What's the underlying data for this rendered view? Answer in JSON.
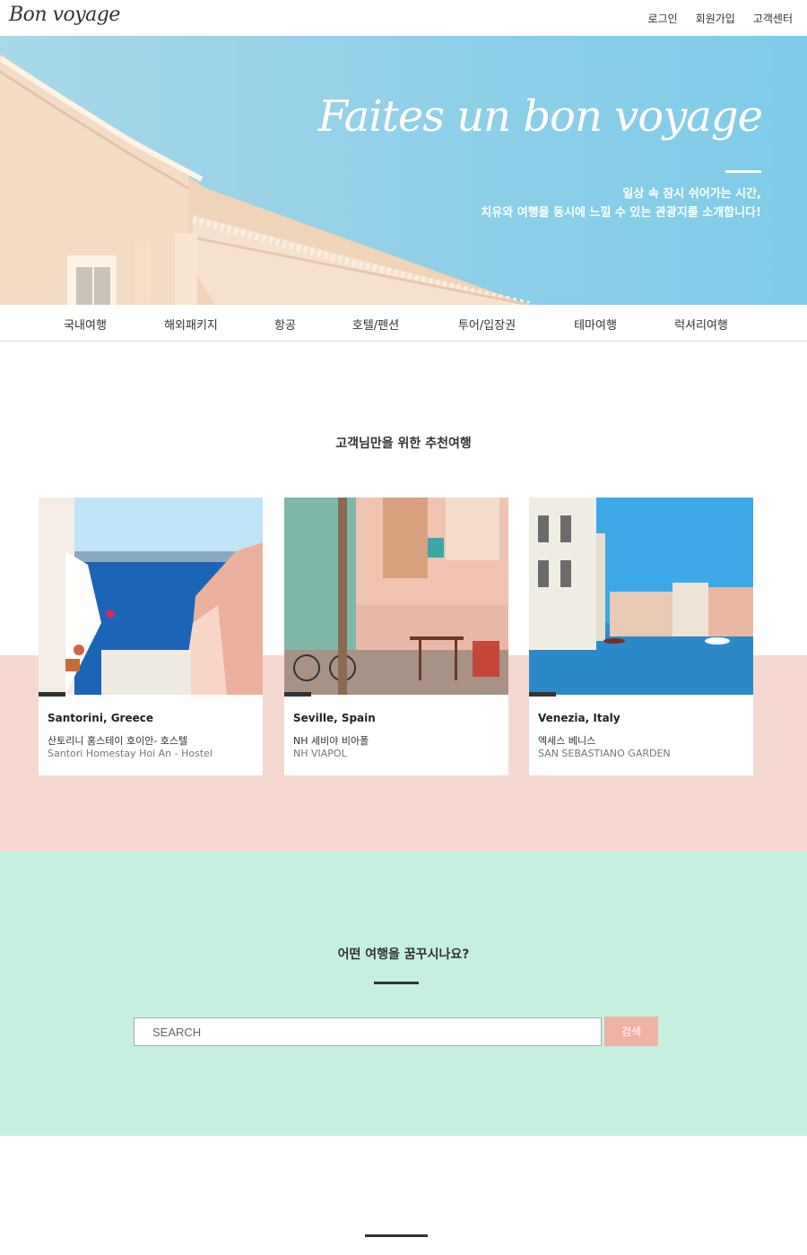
{
  "header": {
    "logo": "Bon voyage",
    "links": [
      "로그인",
      "회원가입",
      "고객센터"
    ]
  },
  "hero": {
    "title": "Faites un bon voyage",
    "subtitle_line1": "일상 속 잠시 쉬어가는 시간,",
    "subtitle_line2": "치유와 여행을 동시에 느낄 수 있는 관광지를 소개합니다!"
  },
  "nav": {
    "items": [
      "국내여행",
      "해외패키지",
      "항공",
      "호텔/펜션",
      "투어/입장권",
      "테마여행",
      "럭셔리여행"
    ]
  },
  "recommended": {
    "title": "고객님만을 위한 추천여행",
    "cards": [
      {
        "name": "Santorini, Greece",
        "ko": "산토리니 홈스테이 호이안- 호스텔",
        "en": "Santori Homestay Hoi An - Hostel"
      },
      {
        "name": "Seville, Spain",
        "ko": "NH 세비야 비아폴",
        "en": "NH VIAPOL"
      },
      {
        "name": "Venezia, Italy",
        "ko": "엑세스 베니스",
        "en": "SAN SEBASTIANO GARDEN"
      }
    ]
  },
  "search": {
    "title": "어떤 여행을 꿈꾸시나요?",
    "placeholder": "SEARCH",
    "button": "검색"
  },
  "colors": {
    "pink_band": "#f5d9d0",
    "mint": "#c5f0e0",
    "search_button": "#f0b2a4",
    "sky": "#8ecfe8"
  }
}
